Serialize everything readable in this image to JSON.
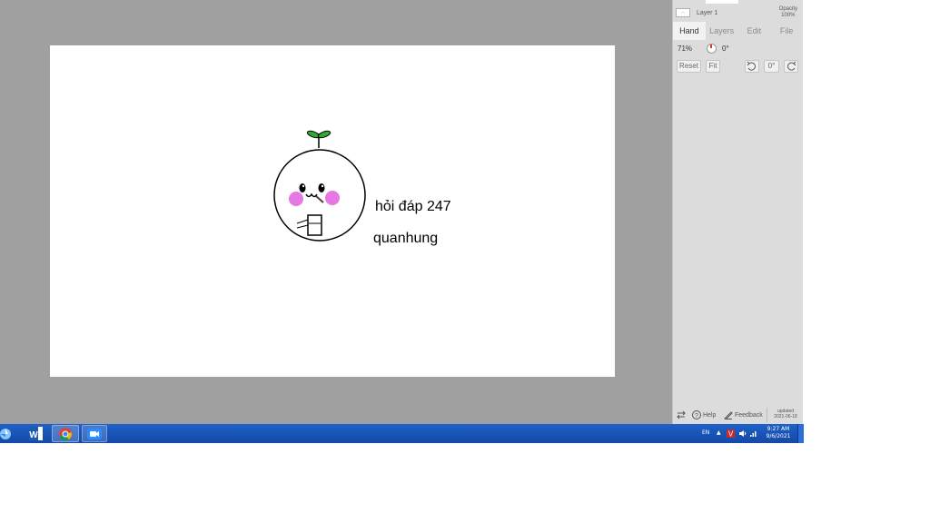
{
  "canvas": {
    "text1": "hỏi đáp 247",
    "text2": "quanhung"
  },
  "layer": {
    "thumb_label": "··",
    "name": "Layer 1",
    "opacity_label": "Opacity",
    "opacity_value": "100%"
  },
  "tabs": [
    {
      "label": "Hand",
      "active": true
    },
    {
      "label": "Layers",
      "active": false
    },
    {
      "label": "Edit",
      "active": false
    },
    {
      "label": "File",
      "active": false
    }
  ],
  "view": {
    "zoom": "71%",
    "rotation": "0°"
  },
  "buttons": {
    "reset": "Reset",
    "fit": "Fit",
    "rotate_value": "0°"
  },
  "footer": {
    "help": "Help",
    "feedback": "Feedback",
    "updated_label": "updated",
    "updated_date": "2021-06-18"
  },
  "taskbar": {
    "lang": "EN",
    "time": "9:27 AM",
    "date": "9/6/2021"
  },
  "colors": {
    "workspace": "#a0a0a0",
    "panel": "#dcdcdc",
    "taskbar": "#1e62c9",
    "blush": "#e060e0",
    "sprout": "#2eaa2e"
  },
  "icons": [
    "pinwheel-icon",
    "word-icon",
    "chrome-icon",
    "zoom-icon",
    "compass-icon",
    "rotate-left-icon",
    "rotate-right-icon",
    "swap-icon",
    "help-icon",
    "feedback-icon",
    "volume-icon",
    "network-icon"
  ]
}
